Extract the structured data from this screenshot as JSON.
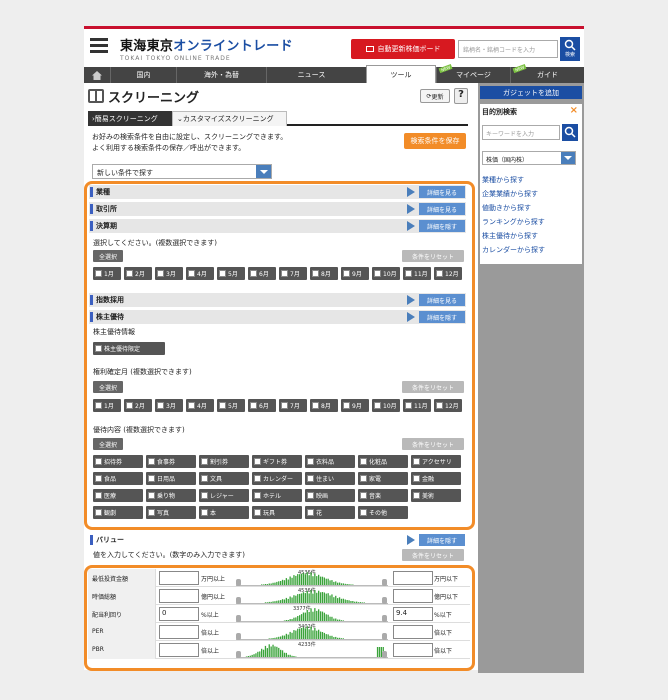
{
  "header": {
    "logo_main": "東海東京",
    "logo_accent": "オンライントレード",
    "logo_sub": "TOKAI TOKYO ONLINE TRADE",
    "board_button": "自動更新株価ボード",
    "search_placeholder": "銘柄名・銘柄コードを入力",
    "search_button": "検索"
  },
  "nav": {
    "items": [
      "国内",
      "海外・為替",
      "ニュース",
      "ツール",
      "マイページ",
      "ガイド"
    ],
    "active": "ツール",
    "new_badge": "NEW"
  },
  "page": {
    "title": "スクリーニング",
    "update_button": "更新",
    "help_button": "?",
    "tabs": [
      "›簡易スクリーニング",
      "⌄カスタマイズスクリーニング"
    ],
    "intro_line1": "お好みの検索条件を自由に設定し、スクリーニングできます。",
    "intro_line2": "よく利用する検索条件の保存／呼出ができます。",
    "save_button": "検索条件を保存",
    "condition_select": "新しい条件で探す"
  },
  "sections": {
    "gyoshu": "業種",
    "torihikisho": "取引所",
    "kessanki": "決算期",
    "shisu": "指数採用",
    "yutai": "株主優待",
    "value": "バリュー",
    "show_detail": "詳細を見る",
    "hide_detail": "詳細を隠す"
  },
  "common": {
    "select_multi": "選択してください。(複数選択できます)",
    "select_all": "全選択",
    "reset": "条件をリセット"
  },
  "months": [
    "1月",
    "2月",
    "3月",
    "4月",
    "5月",
    "6月",
    "7月",
    "8月",
    "9月",
    "10月",
    "11月",
    "12月"
  ],
  "yutai": {
    "info_label": "株主優待情報",
    "info_check": "株主優待限定",
    "record_month_label": "権利確定月 (複数選択できます)",
    "content_label": "優待内容 (複数選択できます)",
    "contents": [
      "招待券",
      "食事券",
      "割引券",
      "ギフト券",
      "衣料品",
      "化粧品",
      "アクセサリ",
      "食品",
      "日用品",
      "文具",
      "カレンダー",
      "住まい",
      "家電",
      "金融",
      "医療",
      "乗り物",
      "レジャー",
      "ホテル",
      "映画",
      "音楽",
      "美術",
      "観劇",
      "写真",
      "本",
      "玩具",
      "花",
      "その他"
    ]
  },
  "value": {
    "instruction": "値を入力してください。(数字のみ入力できます)",
    "rows": [
      {
        "name": "最低投資金額",
        "min": "",
        "min_unit": "万円以上",
        "max": "",
        "max_unit": "万円以下",
        "count": "4536件"
      },
      {
        "name": "時価総額",
        "min": "",
        "min_unit": "億円以上",
        "max": "",
        "max_unit": "億円以下",
        "count": "4536件"
      },
      {
        "name": "配当利回り",
        "min": "0",
        "min_unit": "%以上",
        "max": "9.4",
        "max_unit": "%以下",
        "count": "3377件"
      },
      {
        "name": "PER",
        "min": "",
        "min_unit": "倍以上",
        "max": "",
        "max_unit": "倍以下",
        "count": "3402件"
      },
      {
        "name": "PBR",
        "min": "",
        "min_unit": "倍以上",
        "max": "",
        "max_unit": "倍以下",
        "count": "4233件"
      }
    ]
  },
  "sidebar": {
    "gadget_button": "ガジェットを追加",
    "panel_title": "目的別検索",
    "keyword_placeholder": "キーワードを入力",
    "category_select": "株価（国内株）",
    "links": [
      "業種から探す",
      "企業業績から探す",
      "値動きから探す",
      "ランキングから探す",
      "株主優待から探す",
      "カレンダーから探す"
    ]
  },
  "colors": {
    "accent_orange": "#f28c28",
    "brand_blue": "#1b4ea3",
    "brand_red": "#d71920",
    "histogram_green": "#3aa33a"
  }
}
